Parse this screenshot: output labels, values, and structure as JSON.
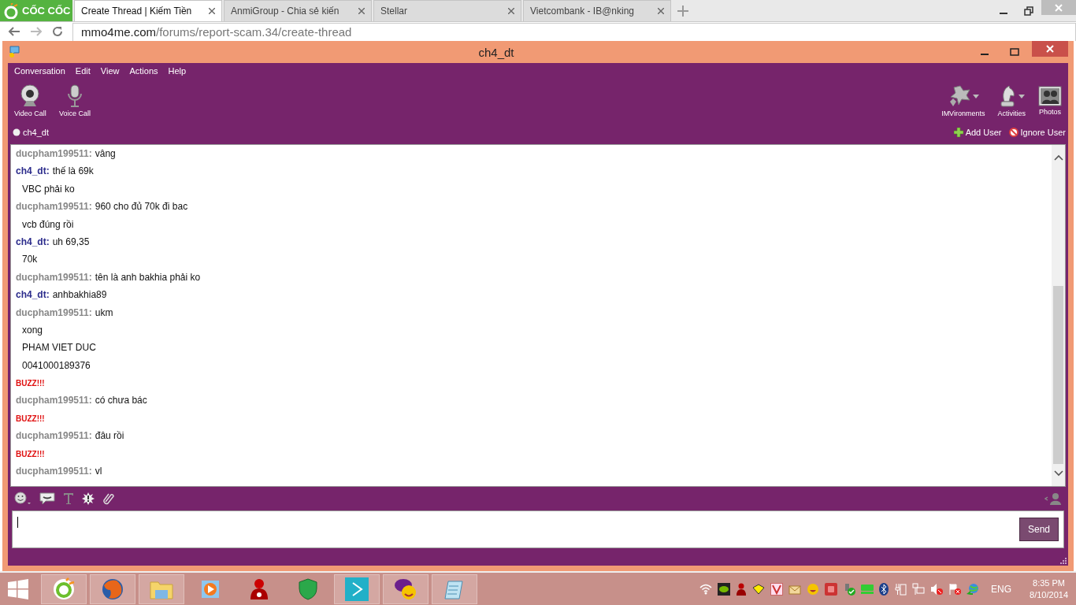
{
  "browser": {
    "brand": "CỐC CỐC",
    "tabs": [
      {
        "label": "Create Thread | Kiếm Tiền",
        "selected": true
      },
      {
        "label": "AnmiGroup - Chia sẻ kiến",
        "selected": false
      },
      {
        "label": "Stellar",
        "selected": false
      },
      {
        "label": "Vietcombank - IB@nking",
        "selected": false
      }
    ],
    "url_host": "mmo4me.com",
    "url_path": "/forums/report-scam.34/create-thread"
  },
  "window": {
    "title": "ch4_dt",
    "menu": [
      "Conversation",
      "Edit",
      "View",
      "Actions",
      "Help"
    ],
    "left_tools": [
      {
        "label": "Video Call"
      },
      {
        "label": "Voice Call"
      }
    ],
    "right_tools": [
      {
        "label": "IMVironments",
        "dropdown": true
      },
      {
        "label": "Activities",
        "dropdown": true
      },
      {
        "label": "Photos",
        "dropdown": false
      }
    ],
    "contact": {
      "name": "ch4_dt"
    },
    "add_user": "Add User",
    "ignore_user": "Ignore User",
    "messages": [
      {
        "kind": "peer",
        "sender": "ducpham199511:",
        "text": "vâng"
      },
      {
        "kind": "self",
        "sender": "ch4_dt:",
        "text": "thế là 69k"
      },
      {
        "kind": "line",
        "text": "VBC phải ko"
      },
      {
        "kind": "peer",
        "sender": "ducpham199511:",
        "text": "960 cho đủ 70k đi bac"
      },
      {
        "kind": "line",
        "text": "vcb đúng rồi"
      },
      {
        "kind": "self",
        "sender": "ch4_dt:",
        "text": "uh 69,35"
      },
      {
        "kind": "line",
        "text": "70k"
      },
      {
        "kind": "peer",
        "sender": "ducpham199511:",
        "text": "tên là anh bakhia phải ko"
      },
      {
        "kind": "self",
        "sender": "ch4_dt:",
        "text": "anhbakhia89"
      },
      {
        "kind": "peer",
        "sender": "ducpham199511:",
        "text": "ukm"
      },
      {
        "kind": "line",
        "text": "xong"
      },
      {
        "kind": "line",
        "text": "PHAM VIET DUC"
      },
      {
        "kind": "line",
        "text": "0041000189376"
      },
      {
        "kind": "buzz",
        "text": "BUZZ!!!"
      },
      {
        "kind": "peer",
        "sender": "ducpham199511:",
        "text": "có chưa bác"
      },
      {
        "kind": "buzz",
        "text": "BUZZ!!!"
      },
      {
        "kind": "peer",
        "sender": "ducpham199511:",
        "text": "đâu rồi"
      },
      {
        "kind": "buzz",
        "text": "BUZZ!!!"
      },
      {
        "kind": "peer",
        "sender": "ducpham199511:",
        "text": "vl"
      }
    ],
    "send": "Send"
  },
  "taskbar": {
    "apps": [
      {
        "running": true
      },
      {
        "running": true
      },
      {
        "running": true
      },
      {
        "running": false
      },
      {
        "running": false
      },
      {
        "running": false
      },
      {
        "running": true
      },
      {
        "running": true
      },
      {
        "running": true
      }
    ],
    "language": "ENG",
    "time": "8:35 PM",
    "date": "8/10/2014"
  }
}
